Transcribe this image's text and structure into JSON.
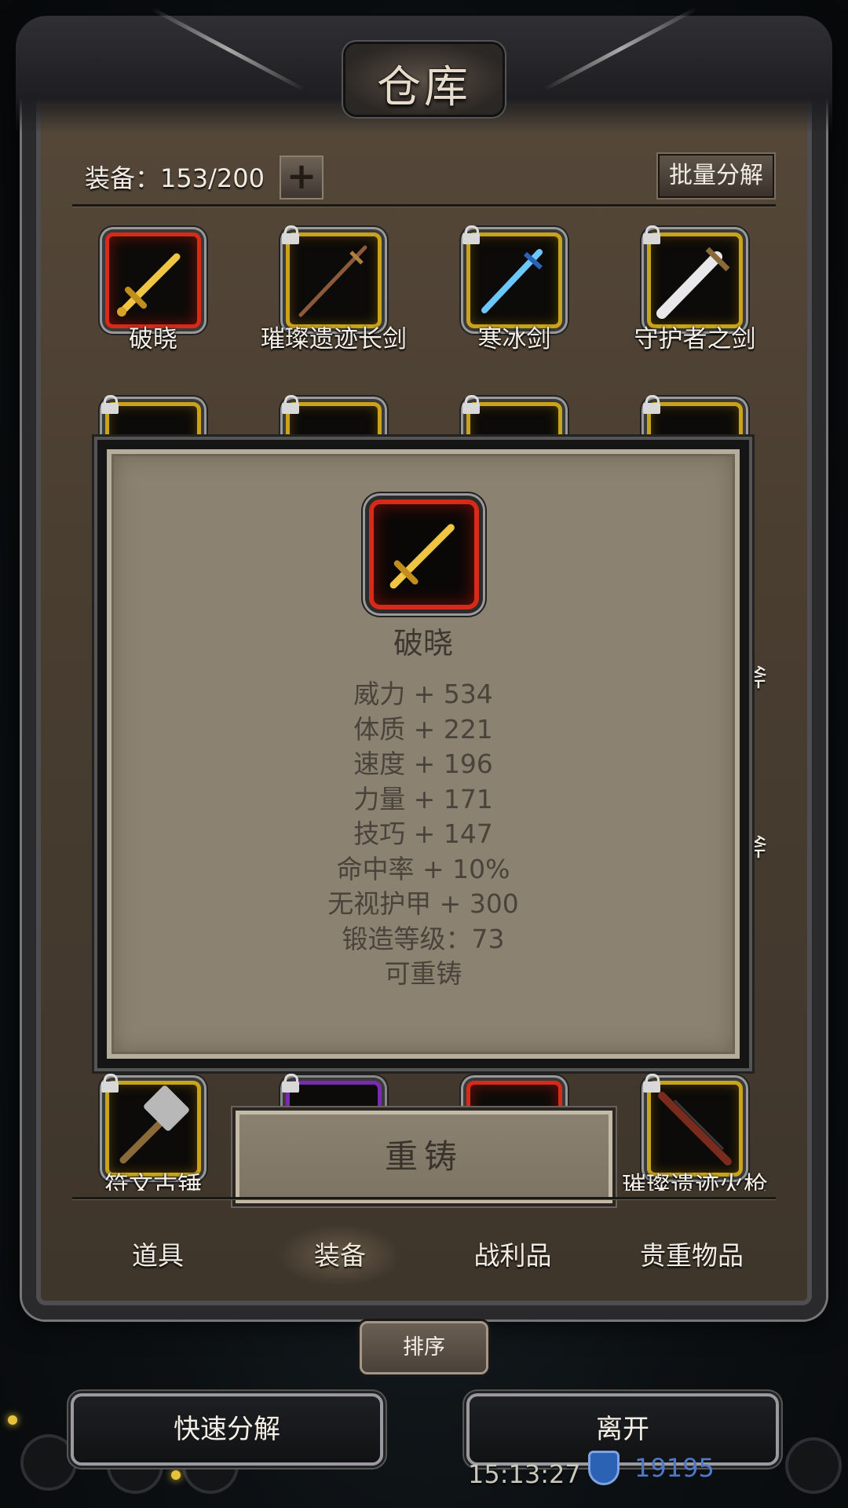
{
  "window": {
    "title": "仓库"
  },
  "header": {
    "count_label": "装备：153/200",
    "plus_label": "+",
    "bulk_button": "批量分解"
  },
  "grid": {
    "row1": [
      {
        "label": "破晓",
        "rarity": "red",
        "locked": false,
        "icon": "golden-sword-icon"
      },
      {
        "label": "璀璨遗迹长剑",
        "rarity": "gold",
        "locked": true,
        "icon": "long-sword-icon"
      },
      {
        "label": "寒冰剑",
        "rarity": "gold",
        "locked": true,
        "icon": "ice-sword-icon"
      },
      {
        "label": "守护者之剑",
        "rarity": "gold",
        "locked": true,
        "icon": "guardian-sword-icon"
      }
    ],
    "hidden_right_labels": [
      "斧",
      "斧"
    ],
    "bottom_row": [
      {
        "label": "符文古锤",
        "rarity": "gold",
        "locked": true,
        "icon": "hammer-icon"
      },
      {
        "label": "",
        "rarity": "purple",
        "locked": true,
        "icon": "hammer-icon"
      },
      {
        "label": "",
        "rarity": "red",
        "locked": false,
        "icon": "rifle-icon"
      },
      {
        "label": "璀璨遗迹火枪",
        "rarity": "gold",
        "locked": true,
        "icon": "musket-icon"
      }
    ]
  },
  "popup": {
    "item_name": "破晓",
    "stats": [
      "威力 + 534",
      "体质 + 221",
      "速度 + 196",
      "力量 + 171",
      "技巧 + 147",
      "命中率 + 10%",
      "无视护甲 + 300",
      "锻造等级：73",
      "可重铸"
    ],
    "action_button": "重铸"
  },
  "tabs": [
    {
      "label": "道具",
      "active": false
    },
    {
      "label": "装备",
      "active": true
    },
    {
      "label": "战利品",
      "active": false
    },
    {
      "label": "贵重物品",
      "active": false
    }
  ],
  "sort_button": "排序",
  "bottom_buttons": {
    "quick_dismantle": "快速分解",
    "leave": "离开"
  },
  "status": {
    "clock": "15:13:27",
    "currency": "19195"
  },
  "colors": {
    "rarity_red": "#d72a17",
    "rarity_gold": "#c9a31a",
    "rarity_purple": "#7b2ab4",
    "popup_bg": "#8c8272"
  }
}
